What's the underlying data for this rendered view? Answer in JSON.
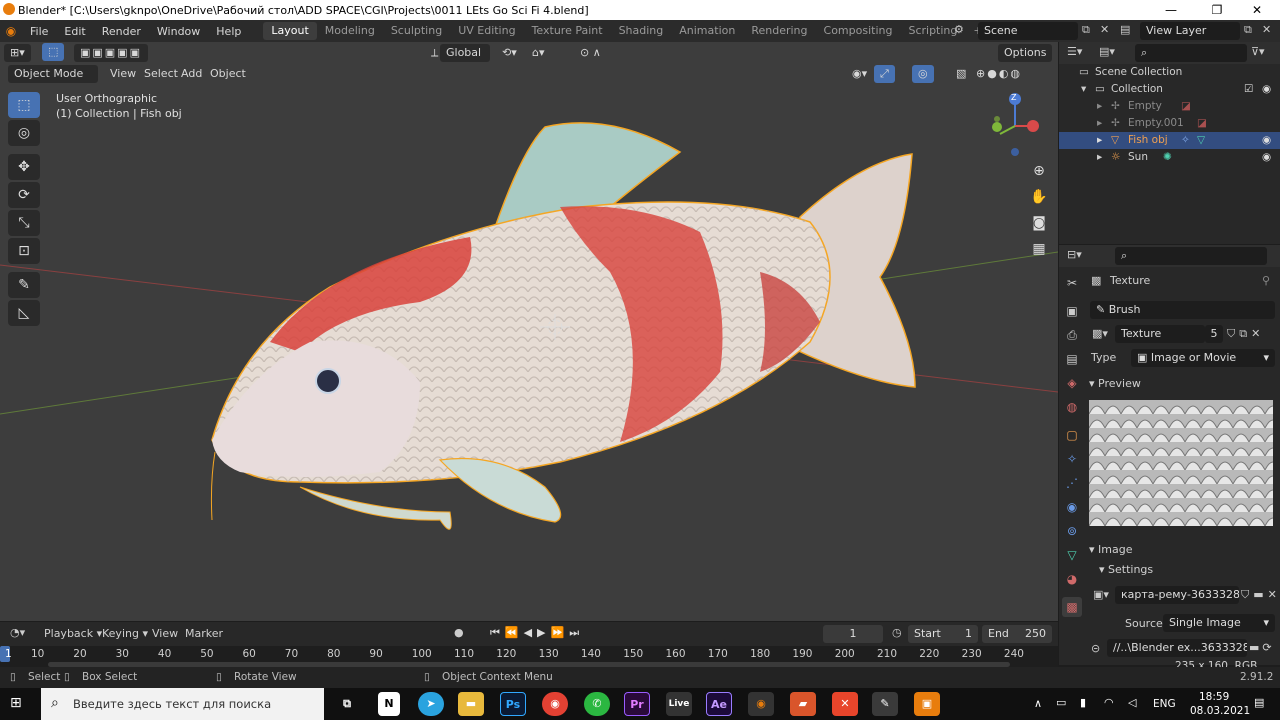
{
  "window": {
    "title": "Blender* [C:\\Users\\gknpo\\OneDrive\\Рабочий стол\\ADD SPACE\\CGI\\Projects\\0011 LEts Go Sci Fi 4.blend]",
    "minimize": "—",
    "maximize": "❐",
    "close": "✕"
  },
  "menu": {
    "items": [
      "File",
      "Edit",
      "Render",
      "Window",
      "Help"
    ],
    "workspaces": [
      "Layout",
      "Modeling",
      "Sculpting",
      "UV Editing",
      "Texture Paint",
      "Shading",
      "Animation",
      "Rendering",
      "Compositing",
      "Scripting"
    ],
    "active_workspace": "Layout",
    "add_workspace": "+",
    "scene_label": "Scene",
    "view_layer_label": "View Layer"
  },
  "viewport": {
    "mode": "Object Mode",
    "menus": [
      "View",
      "Select",
      "Add",
      "Object"
    ],
    "transform_orientation": "Global",
    "options": "Options",
    "view_name": "User Orthographic",
    "collection_info": "(1) Collection | Fish obj",
    "gizmo_z": "Z"
  },
  "outliner": {
    "root": "Scene Collection",
    "collection": "Collection",
    "items": [
      {
        "name": "Empty",
        "dim": true
      },
      {
        "name": "Empty.001",
        "dim": true
      },
      {
        "name": "Fish obj",
        "dim": false,
        "selected": true
      },
      {
        "name": "Sun",
        "dim": false
      }
    ]
  },
  "properties": {
    "header": "Texture",
    "brush": "Brush",
    "texture_name": "Texture",
    "texture_users": "5",
    "type_label": "Type",
    "type_value": "Image or Movie",
    "preview_label": "Preview",
    "image_label": "Image",
    "settings_label": "Settings",
    "image_name": "карта-рему-3633328...",
    "source_label": "Source",
    "source_value": "Single Image",
    "filepath": "//..\\Blender ex...36333287.jpg",
    "image_info": "235 x 160,  RGB byte"
  },
  "timeline": {
    "menus": [
      "Playback",
      "Keying",
      "View",
      "Marker"
    ],
    "current_frame": "1",
    "start_label": "Start",
    "start_value": "1",
    "end_label": "End",
    "end_value": "250",
    "ticks": [
      "1",
      "10",
      "20",
      "30",
      "40",
      "50",
      "60",
      "70",
      "80",
      "90",
      "100",
      "110",
      "120",
      "130",
      "140",
      "150",
      "160",
      "170",
      "180",
      "190",
      "200",
      "210",
      "220",
      "230",
      "240"
    ]
  },
  "status": {
    "select": "Select",
    "box_select": "Box Select",
    "rotate_view": "Rotate View",
    "context_menu": "Object Context Menu",
    "version": "2.91.2"
  },
  "taskbar": {
    "search_placeholder": "Введите здесь текст для поиска",
    "language": "ENG",
    "time": "18:59",
    "date": "08.03.2021"
  },
  "colors": {
    "accent": "#4772b3",
    "selection_outline": "#f5a623",
    "selected_row": "#334d80"
  }
}
